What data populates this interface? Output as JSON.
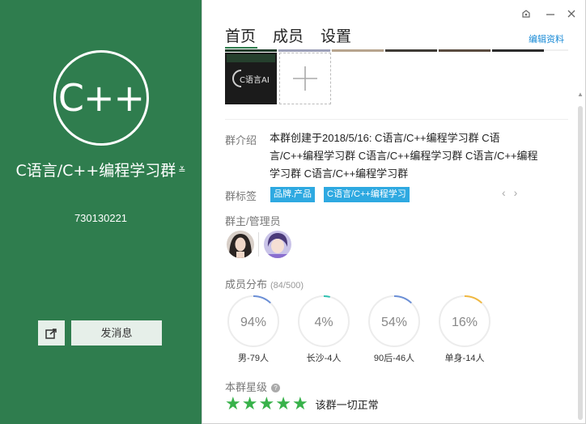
{
  "left": {
    "logo_text": "C++",
    "group_name": "C语言/C++编程学习群",
    "group_tag": "≚",
    "group_id": "730130221",
    "share_icon": "share-icon",
    "send_message_label": "发消息"
  },
  "window": {
    "skin_icon": "skin-icon",
    "minimize_icon": "minimize-icon",
    "close_icon": "close-icon"
  },
  "tabs": [
    "首页",
    "成员",
    "设置"
  ],
  "edit_profile_label": "编辑资料",
  "photo": {
    "text": "C语言AI"
  },
  "intro": {
    "label": "群介绍",
    "text": "本群创建于2018/5/16:  C语言/C++编程学习群 C语言/C++编程学习群 C语言/C++编程学习群 C语言/C++编程学习群 C语言/C++编程学习群"
  },
  "tags": {
    "label": "群标签",
    "items": [
      "品牌.产品",
      "C语言/C++编程学习"
    ]
  },
  "admins": {
    "label": "群主/管理员"
  },
  "distribution": {
    "label": "成员分布",
    "count": "(84/500)",
    "items": [
      {
        "value": "94%",
        "label": "男-79人",
        "fraction": 0.94,
        "color": "#6b8fd6"
      },
      {
        "value": "4%",
        "label": "长沙-4人",
        "fraction": 0.04,
        "color": "#2ec0b0"
      },
      {
        "value": "54%",
        "label": "90后-46人",
        "fraction": 0.54,
        "color": "#6b8fd6"
      },
      {
        "value": "16%",
        "label": "单身-14人",
        "fraction": 0.16,
        "color": "#f0b840"
      }
    ]
  },
  "rating": {
    "label": "本群星级",
    "stars": 5,
    "status": "该群一切正常"
  },
  "colors": {
    "panel_green": "#2f7d4e",
    "tag_blue": "#2ea9e1",
    "star_green": "#38b24a",
    "link_blue": "#1a8bd6"
  }
}
